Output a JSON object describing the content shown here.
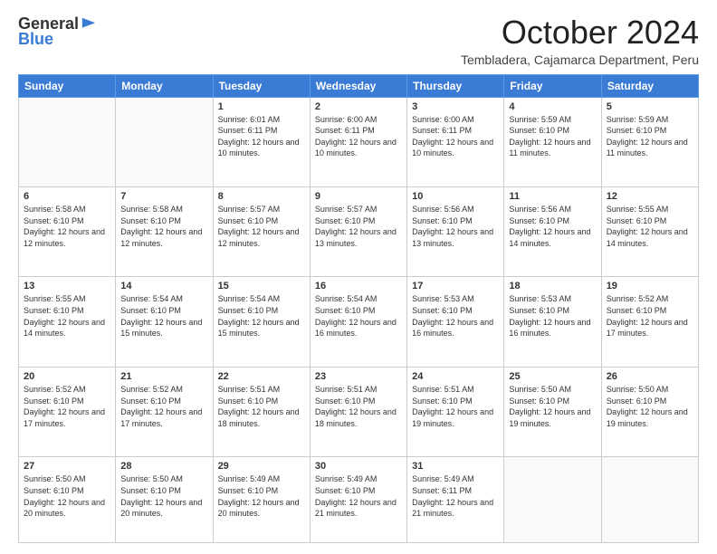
{
  "logo": {
    "general": "General",
    "blue": "Blue"
  },
  "header": {
    "month": "October 2024",
    "subtitle": "Tembladera, Cajamarca Department, Peru"
  },
  "days_of_week": [
    "Sunday",
    "Monday",
    "Tuesday",
    "Wednesday",
    "Thursday",
    "Friday",
    "Saturday"
  ],
  "weeks": [
    [
      {
        "day": "",
        "info": ""
      },
      {
        "day": "",
        "info": ""
      },
      {
        "day": "1",
        "info": "Sunrise: 6:01 AM\nSunset: 6:11 PM\nDaylight: 12 hours and 10 minutes."
      },
      {
        "day": "2",
        "info": "Sunrise: 6:00 AM\nSunset: 6:11 PM\nDaylight: 12 hours and 10 minutes."
      },
      {
        "day": "3",
        "info": "Sunrise: 6:00 AM\nSunset: 6:11 PM\nDaylight: 12 hours and 10 minutes."
      },
      {
        "day": "4",
        "info": "Sunrise: 5:59 AM\nSunset: 6:10 PM\nDaylight: 12 hours and 11 minutes."
      },
      {
        "day": "5",
        "info": "Sunrise: 5:59 AM\nSunset: 6:10 PM\nDaylight: 12 hours and 11 minutes."
      }
    ],
    [
      {
        "day": "6",
        "info": "Sunrise: 5:58 AM\nSunset: 6:10 PM\nDaylight: 12 hours and 12 minutes."
      },
      {
        "day": "7",
        "info": "Sunrise: 5:58 AM\nSunset: 6:10 PM\nDaylight: 12 hours and 12 minutes."
      },
      {
        "day": "8",
        "info": "Sunrise: 5:57 AM\nSunset: 6:10 PM\nDaylight: 12 hours and 12 minutes."
      },
      {
        "day": "9",
        "info": "Sunrise: 5:57 AM\nSunset: 6:10 PM\nDaylight: 12 hours and 13 minutes."
      },
      {
        "day": "10",
        "info": "Sunrise: 5:56 AM\nSunset: 6:10 PM\nDaylight: 12 hours and 13 minutes."
      },
      {
        "day": "11",
        "info": "Sunrise: 5:56 AM\nSunset: 6:10 PM\nDaylight: 12 hours and 14 minutes."
      },
      {
        "day": "12",
        "info": "Sunrise: 5:55 AM\nSunset: 6:10 PM\nDaylight: 12 hours and 14 minutes."
      }
    ],
    [
      {
        "day": "13",
        "info": "Sunrise: 5:55 AM\nSunset: 6:10 PM\nDaylight: 12 hours and 14 minutes."
      },
      {
        "day": "14",
        "info": "Sunrise: 5:54 AM\nSunset: 6:10 PM\nDaylight: 12 hours and 15 minutes."
      },
      {
        "day": "15",
        "info": "Sunrise: 5:54 AM\nSunset: 6:10 PM\nDaylight: 12 hours and 15 minutes."
      },
      {
        "day": "16",
        "info": "Sunrise: 5:54 AM\nSunset: 6:10 PM\nDaylight: 12 hours and 16 minutes."
      },
      {
        "day": "17",
        "info": "Sunrise: 5:53 AM\nSunset: 6:10 PM\nDaylight: 12 hours and 16 minutes."
      },
      {
        "day": "18",
        "info": "Sunrise: 5:53 AM\nSunset: 6:10 PM\nDaylight: 12 hours and 16 minutes."
      },
      {
        "day": "19",
        "info": "Sunrise: 5:52 AM\nSunset: 6:10 PM\nDaylight: 12 hours and 17 minutes."
      }
    ],
    [
      {
        "day": "20",
        "info": "Sunrise: 5:52 AM\nSunset: 6:10 PM\nDaylight: 12 hours and 17 minutes."
      },
      {
        "day": "21",
        "info": "Sunrise: 5:52 AM\nSunset: 6:10 PM\nDaylight: 12 hours and 17 minutes."
      },
      {
        "day": "22",
        "info": "Sunrise: 5:51 AM\nSunset: 6:10 PM\nDaylight: 12 hours and 18 minutes."
      },
      {
        "day": "23",
        "info": "Sunrise: 5:51 AM\nSunset: 6:10 PM\nDaylight: 12 hours and 18 minutes."
      },
      {
        "day": "24",
        "info": "Sunrise: 5:51 AM\nSunset: 6:10 PM\nDaylight: 12 hours and 19 minutes."
      },
      {
        "day": "25",
        "info": "Sunrise: 5:50 AM\nSunset: 6:10 PM\nDaylight: 12 hours and 19 minutes."
      },
      {
        "day": "26",
        "info": "Sunrise: 5:50 AM\nSunset: 6:10 PM\nDaylight: 12 hours and 19 minutes."
      }
    ],
    [
      {
        "day": "27",
        "info": "Sunrise: 5:50 AM\nSunset: 6:10 PM\nDaylight: 12 hours and 20 minutes."
      },
      {
        "day": "28",
        "info": "Sunrise: 5:50 AM\nSunset: 6:10 PM\nDaylight: 12 hours and 20 minutes."
      },
      {
        "day": "29",
        "info": "Sunrise: 5:49 AM\nSunset: 6:10 PM\nDaylight: 12 hours and 20 minutes."
      },
      {
        "day": "30",
        "info": "Sunrise: 5:49 AM\nSunset: 6:10 PM\nDaylight: 12 hours and 21 minutes."
      },
      {
        "day": "31",
        "info": "Sunrise: 5:49 AM\nSunset: 6:11 PM\nDaylight: 12 hours and 21 minutes."
      },
      {
        "day": "",
        "info": ""
      },
      {
        "day": "",
        "info": ""
      }
    ]
  ]
}
